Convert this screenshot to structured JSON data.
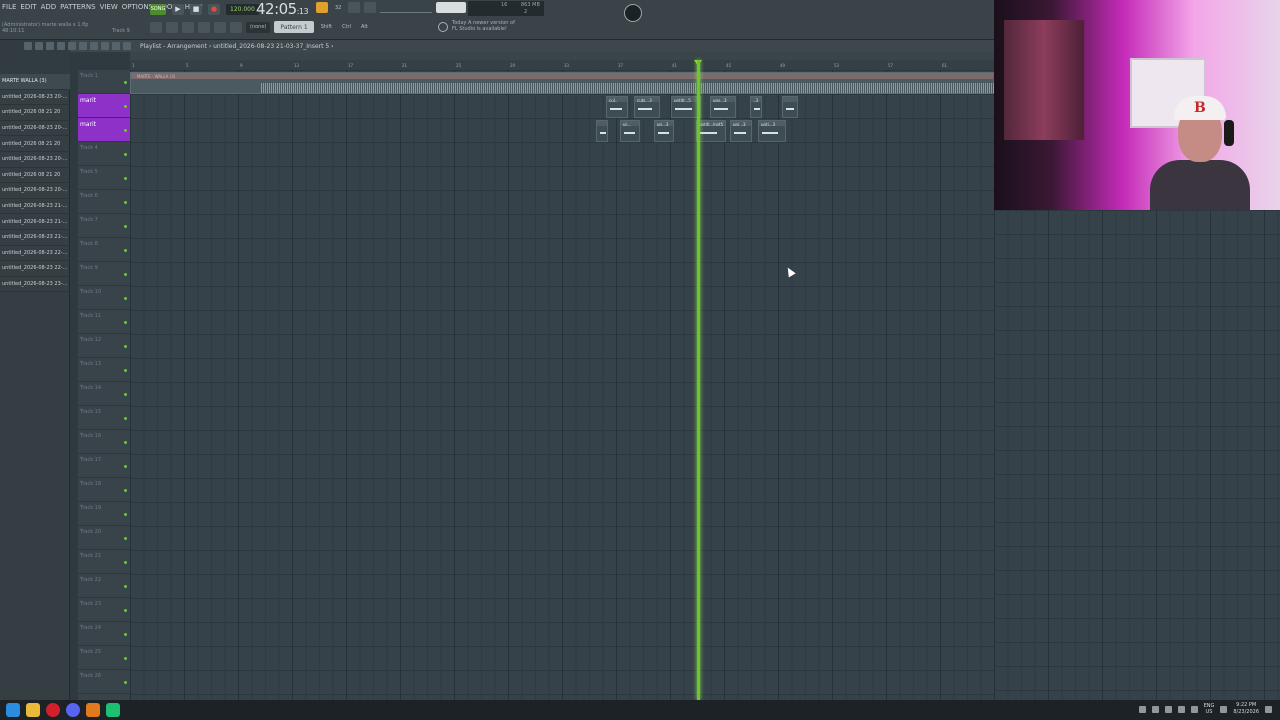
{
  "menu": [
    "FILE",
    "EDIT",
    "ADD",
    "PATTERNS",
    "VIEW",
    "OPTIONS",
    "TOOLS",
    "HELP"
  ],
  "hint": {
    "line1": "(Administrator)  marte walla x 1.flp",
    "line2": "48:10:11",
    "line3": "Track 9"
  },
  "transport": {
    "mode": "SONG",
    "tempo": "120.000",
    "time_main": "42:05",
    "time_sub": ":13",
    "time_sig": "32"
  },
  "cpu": {
    "value": "16",
    "memory": "863 MB",
    "voices": "2"
  },
  "row2": {
    "none": "(none)",
    "pattern": "Pattern 1",
    "shift": "Shift",
    "ctrl": "Ctrl",
    "alt": "Alt"
  },
  "news": {
    "line1": "Today  A newer version of",
    "line2": "FL Studio is available!"
  },
  "playlist": {
    "title": "Playlist - Arrangement  ›  untitled_2026-08-23 21-03-37_Insert 5 ›"
  },
  "browser": {
    "header": "MARTE WALLA (3)",
    "items": [
      "untitled_2026-08-23 20-...",
      "untitled_2026 08 21 20",
      "untitled_2026-08-23 20-...",
      "untitled_2026 08 21 20",
      "untitled_2026-08-23 20-...",
      "untitled_2026 08 21 20",
      "untitled_2026-08-23 20-...",
      "untitled_2026-08-23 21-...",
      "untitled_2026-08-23 21-...",
      "untitled_2026-08-23 21-...",
      "untitled_2026-08-23 22-...",
      "untitled_2026-08-23 22-...",
      "untitled_2026-08-23 23-..."
    ]
  },
  "tracks": [
    "Track 1",
    "marit",
    "marit",
    "Track 4",
    "Track 5",
    "Track 6",
    "Track 7",
    "Track 8",
    "Track 9",
    "Track 10",
    "Track 11",
    "Track 12",
    "Track 13",
    "Track 14",
    "Track 15",
    "Track 16",
    "Track 17",
    "Track 18",
    "Track 19",
    "Track 20",
    "Track 21",
    "Track 22",
    "Track 23",
    "Track 24",
    "Track 25",
    "Track 26"
  ],
  "audio_clip": {
    "label": "MARTE - WALLA (3)"
  },
  "pattern_clips": {
    "row1": [
      "cul..",
      "cuts...3",
      "untitl...5",
      "uns...3",
      "..3",
      ""
    ],
    "row2": [
      "",
      "ul...",
      "un...3",
      "untitl...Inst5",
      "uni...3",
      "unti...3"
    ]
  },
  "ruler_ticks": [
    "1",
    "5",
    "9",
    "13",
    "17",
    "21",
    "25",
    "29",
    "33",
    "37",
    "41",
    "45",
    "49",
    "53",
    "57",
    "61"
  ],
  "taskbar": {
    "lang_top": "ENG",
    "lang_bottom": "US",
    "time": "9:22 PM",
    "date": "8/23/2026"
  },
  "colors": {
    "playhead": "#6cc72c",
    "track_highlight": "#8e31c9",
    "record": "#e04a3c"
  },
  "icons": [
    "play-icon",
    "stop-icon",
    "record-icon",
    "steam-icon",
    "windows-start-icon",
    "file-explorer-icon",
    "opera-icon",
    "discord-icon",
    "fl-studio-icon",
    "spotify-icon"
  ]
}
